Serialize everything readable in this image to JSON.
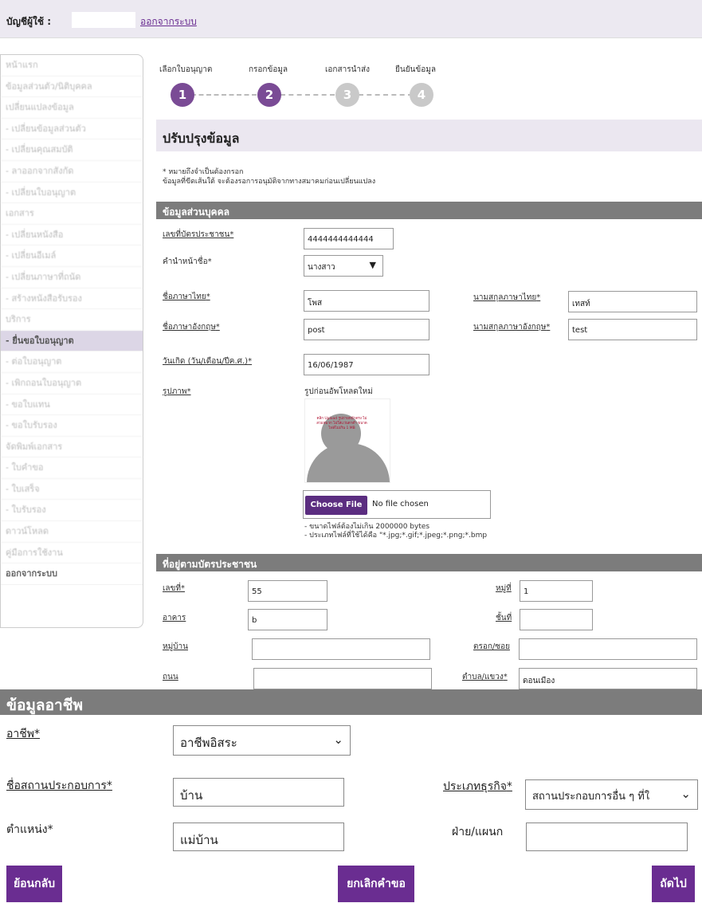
{
  "header": {
    "account_label": "บัญชีผู้ใช้ :",
    "logout_link": "ออกจากระบบ"
  },
  "sidebar": {
    "items": [
      {
        "label": "หน้าแรก"
      },
      {
        "label": "ข้อมูลส่วนตัว/นิติบุคคล"
      },
      {
        "label": "เปลี่ยนแปลงข้อมูล"
      },
      {
        "label": "- เปลี่ยนข้อมูลส่วนตัว"
      },
      {
        "label": "- เปลี่ยนคุณสมบัติ"
      },
      {
        "label": "- ลาออกจากสังกัด"
      },
      {
        "label": "- เปลี่ยนใบอนุญาต"
      },
      {
        "label": "เอกสาร"
      },
      {
        "label": "- เปลี่ยนหนังสือ"
      },
      {
        "label": "- เปลี่ยนอีเมล์"
      },
      {
        "label": "- เปลี่ยนภาษาที่ถนัด"
      },
      {
        "label": "- สร้างหนังสือรับรอง"
      },
      {
        "label": "บริการ"
      },
      {
        "label": "- ยื่นขอใบอนุญาต"
      },
      {
        "label": "- ต่อใบอนุญาต"
      },
      {
        "label": "- เพิกถอนใบอนุญาต"
      },
      {
        "label": "- ขอใบแทน"
      },
      {
        "label": "- ขอใบรับรอง"
      },
      {
        "label": "จัดพิมพ์เอกสาร"
      },
      {
        "label": "- ใบคำขอ"
      },
      {
        "label": "- ใบเสร็จ"
      },
      {
        "label": "- ใบรับรอง"
      },
      {
        "label": "ดาวน์โหลด"
      },
      {
        "label": "คู่มือการใช้งาน"
      },
      {
        "label": "ออกจากระบบ"
      }
    ]
  },
  "steps": [
    {
      "label": "เลือกใบอนุญาต",
      "number": "1"
    },
    {
      "label": "กรอกข้อมูล",
      "number": "2"
    },
    {
      "label": "เอกสารนำส่ง",
      "number": "3"
    },
    {
      "label": "ยืนยันข้อมูล",
      "number": "4"
    }
  ],
  "page_title": "ปรับปรุงข้อมูล",
  "notes": {
    "line1": "* หมายถึงจำเป็นต้องกรอก",
    "line2": "ข้อมูลที่ขีดเส้นใต้ จะต้องรอการอนุมัติจากทางสมาคมก่อนเปลี่ยนแปลง"
  },
  "personal": {
    "section_title": "ข้อมูลส่วนบุคคล",
    "id_label": "เลขที่บัตรประชาชน",
    "id_value": "4444444444444",
    "prefix_label": "คำนำหน้าชื่อ",
    "prefix_value": "นางสาว",
    "first_th_label": "ชื่อภาษาไทย",
    "first_th_value": "โพส",
    "last_th_label": "นามสกุลภาษาไทย",
    "last_th_value": "เทสท์",
    "first_en_label": "ชื่อภาษาอังกฤษ",
    "first_en_value": "post",
    "last_en_label": "นามสกุลภาษาอังกฤษ",
    "last_en_value": "test",
    "dob_label": "วันเกิด (วัน/เดือน/ปีค.ศ.)",
    "dob_value": "16/06/1987",
    "photo_label": "รูปภาพ",
    "photo_hint": "รูปก่อนอัพโหลดใหม่",
    "photo_overlay": "คลิก Upload รูปถ่ายหน้าตรง ไม่สวมหมวก ไม่ใส่แว่นตาดำ ขนาดไฟล์ไม่เกิน 1 MB",
    "choose_file": "Choose File",
    "no_file": "No file chosen",
    "size_note": "- ขนาดไฟล์ต้องไม่เกิน 2000000 bytes",
    "type_note": "- ประเภทไฟล์ที่ใช้ได้คือ \"*.jpg;*.gif;*.jpeg;*.png;*.bmp"
  },
  "address": {
    "section_title": "ที่อยู่ตามบัตรประชาชน",
    "no_label": "เลขที่",
    "no_value": "55",
    "moo_label": "หมู่ที่",
    "moo_value": "1",
    "building_label": "อาคาร",
    "building_value": "b",
    "floor_label": "ชั้นที่",
    "floor_value": "",
    "village_label": "หมู่บ้าน",
    "village_value": "",
    "soi_label": "ตรอก/ซอย",
    "soi_value": "",
    "road_label": "ถนน",
    "road_value": "",
    "subdistrict_label": "ตำบล/แขวง",
    "subdistrict_value": "ดอนเมือง"
  },
  "occupation": {
    "section_title": "ข้อมูลอาชีพ",
    "job_label": "อาชีพ",
    "job_value": "อาชีพอิสระ",
    "workplace_label": "ชื่อสถานประกอบการ",
    "workplace_value": "บ้าน",
    "biztype_label": "ประเภทธุรกิจ",
    "biztype_value": "สถานประกอบการอื่น ๆ ที่ใ",
    "position_label": "ตำแหน่ง",
    "position_value": "แม่บ้าน",
    "dept_label": "ฝ่าย/แผนก",
    "dept_value": ""
  },
  "buttons": {
    "back": "ย้อนกลับ",
    "cancel": "ยกเลิกคำขอ",
    "next": "ถัดไป"
  },
  "colors": {
    "accent": "#6a2d91",
    "section_bar": "#7c7c7c",
    "title_bg": "#ebe7f0"
  }
}
